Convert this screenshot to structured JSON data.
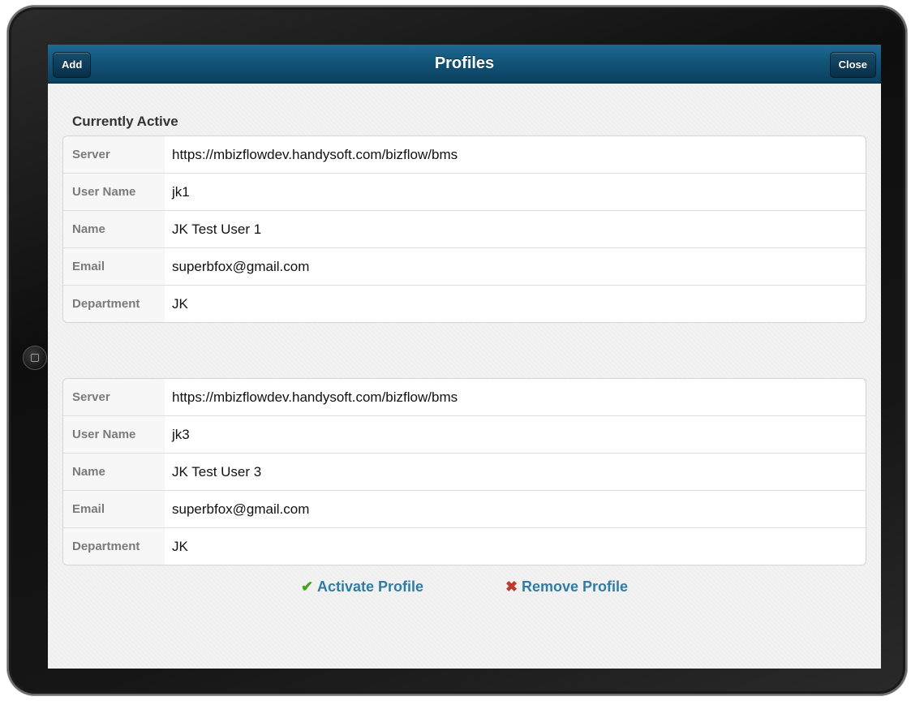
{
  "navbar": {
    "title": "Profiles",
    "add_label": "Add",
    "close_label": "Close"
  },
  "section_title": "Currently Active",
  "profiles": [
    {
      "rows": [
        {
          "label": "Server",
          "value": "https://mbizflowdev.handysoft.com/bizflow/bms"
        },
        {
          "label": "User Name",
          "value": "jk1"
        },
        {
          "label": "Name",
          "value": "JK Test User 1"
        },
        {
          "label": "Email",
          "value": "superbfox@gmail.com"
        },
        {
          "label": "Department",
          "value": "JK"
        }
      ]
    },
    {
      "rows": [
        {
          "label": "Server",
          "value": "https://mbizflowdev.handysoft.com/bizflow/bms"
        },
        {
          "label": "User Name",
          "value": "jk3"
        },
        {
          "label": "Name",
          "value": "JK Test User 3"
        },
        {
          "label": "Email",
          "value": "superbfox@gmail.com"
        },
        {
          "label": "Department",
          "value": "JK"
        }
      ]
    }
  ],
  "actions": {
    "activate_label": "Activate Profile",
    "activate_icon": "checkmark-icon",
    "remove_label": "Remove Profile",
    "remove_icon": "x-icon"
  },
  "colors": {
    "navbar": "#125579",
    "link": "#2e7da4",
    "check": "#4aa11f",
    "cross": "#c0392b"
  }
}
